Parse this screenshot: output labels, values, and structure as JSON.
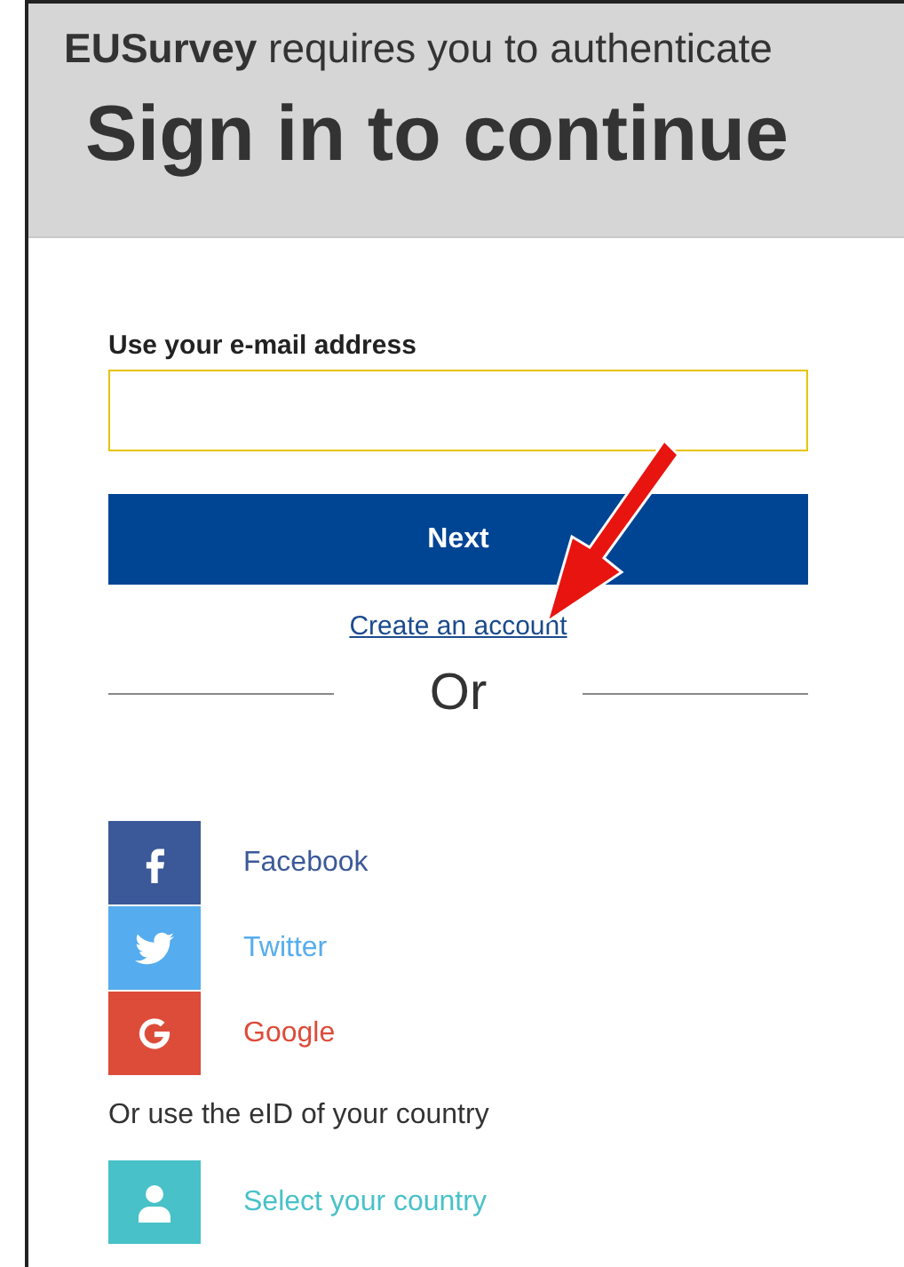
{
  "header": {
    "subtitle": "**EUSurvey** requires you to authenticate",
    "title": "Sign in to continue"
  },
  "email": {
    "label": "Use your e-mail address"
  },
  "next_button": "Next",
  "create_account_link": "Create an account",
  "divider": "Or",
  "providers": [
    {
      "kind": "facebook",
      "label": "Facebook",
      "color": "#3b5998"
    },
    {
      "kind": "twitter",
      "label": "Twitter",
      "color": "#55acee"
    },
    {
      "kind": "google",
      "label": "Google",
      "color": "#dd4b39"
    }
  ],
  "eid_text": "Or use the eID of your country",
  "eid_providers": [
    {
      "kind": "country",
      "label": "Select your country",
      "color": "#48c1c8"
    }
  ]
}
